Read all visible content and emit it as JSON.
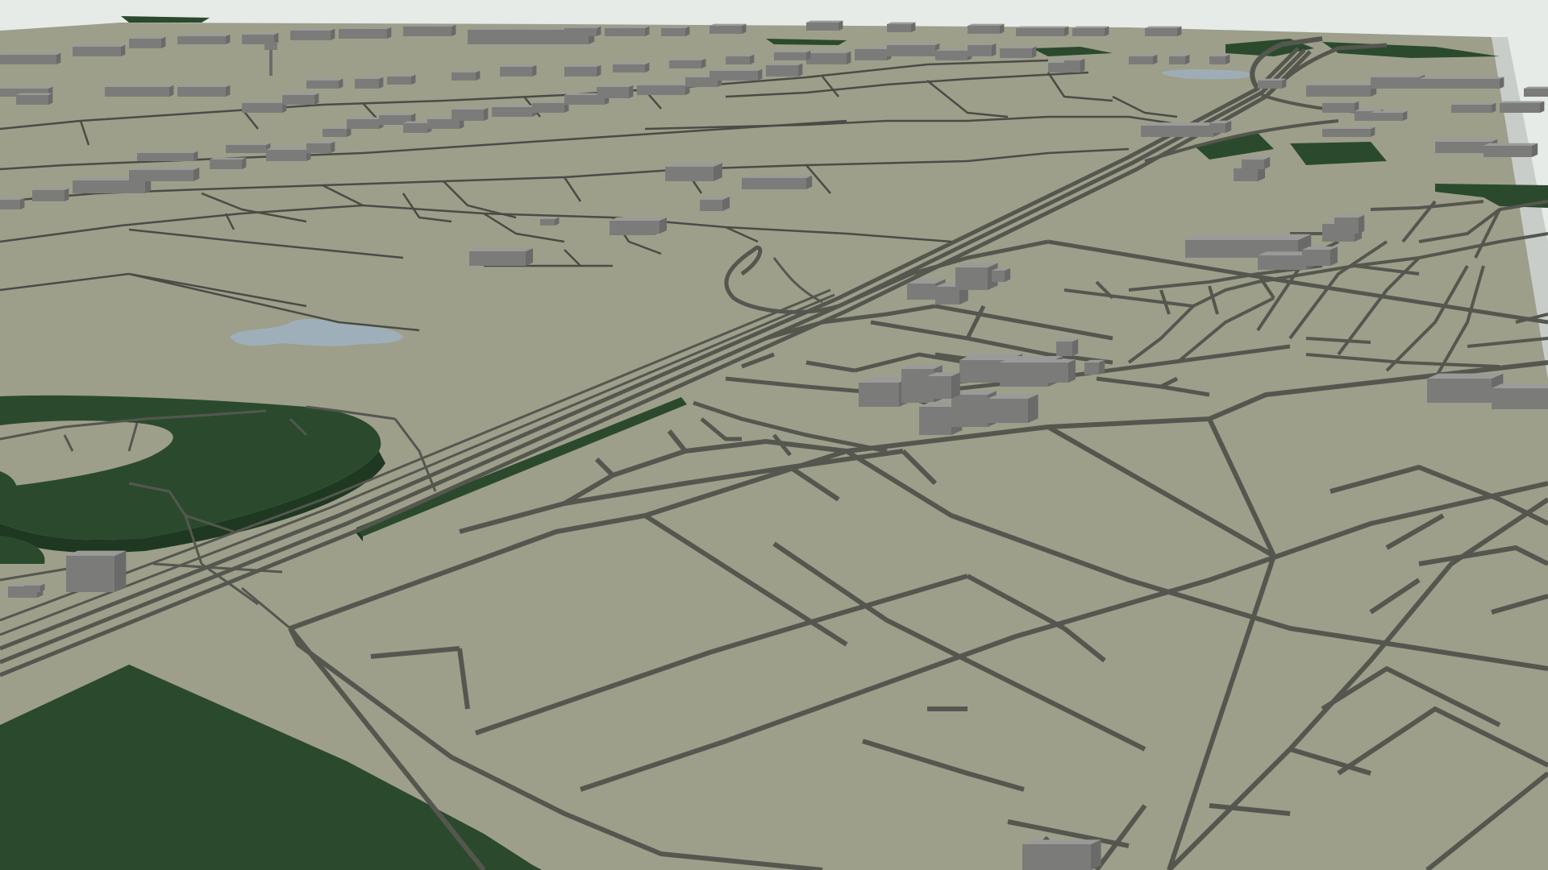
{
  "scene": {
    "kind": "3d-city-map-render",
    "view": "oblique-perspective",
    "labels_visible": false
  },
  "colors": {
    "sky": "#e6ebe8",
    "ground": "#9d9f8b",
    "ground_far": "#a6a895",
    "road": "#55574f",
    "road_edge": "#4a4c45",
    "park_top": "#2b4a2d",
    "park_side": "#1f3821",
    "building_top": "#9a9b98",
    "building_front": "#7b7c7a",
    "building_side": "#6a6b69",
    "water": "#9fb0bf",
    "side_wall": "#c9cdc9"
  },
  "legend": {
    "layers": [
      "ground",
      "roads",
      "railway",
      "parks",
      "buildings",
      "water"
    ]
  }
}
